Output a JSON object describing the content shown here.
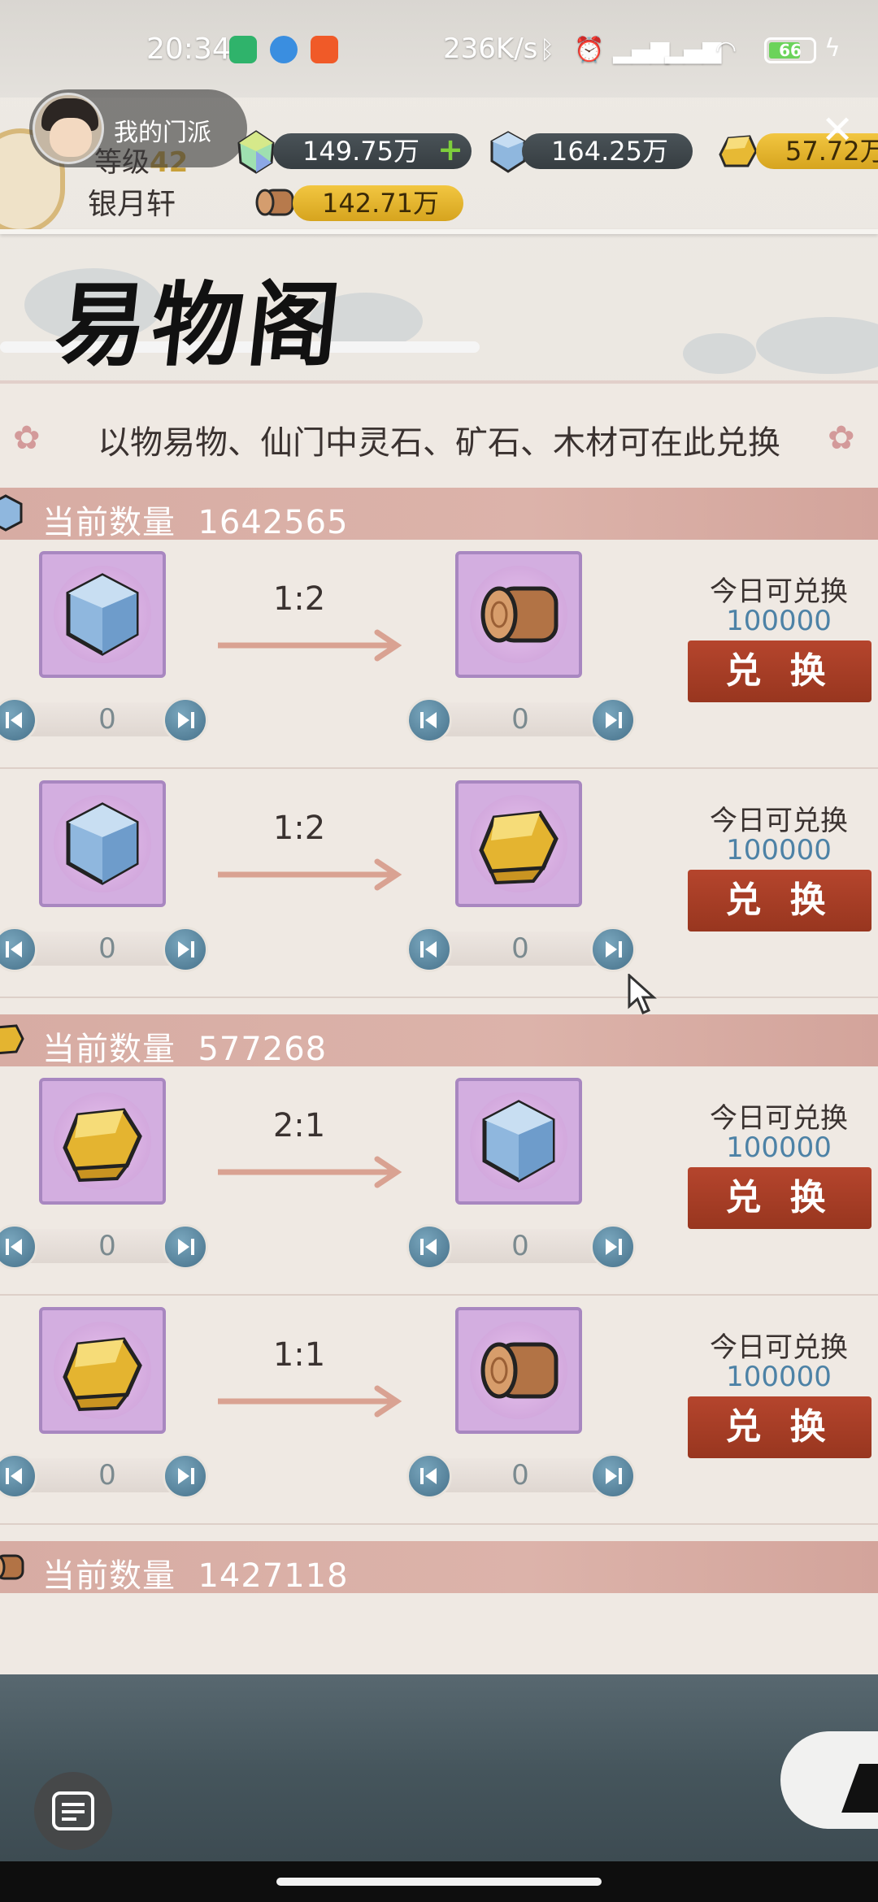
{
  "status_bar": {
    "time": "20:34",
    "network_speed": "236K/s",
    "battery_level": "66"
  },
  "header": {
    "mini_window_label": "我的门派",
    "level_prefix": "等级",
    "level": "42",
    "sect_name": "银月轩",
    "resources": {
      "spirit_stone": "149.75万",
      "ore": "164.25万",
      "gold": "57.72万",
      "wood": "142.71万"
    },
    "close_icon": "close-icon"
  },
  "page": {
    "title": "易物阁",
    "notice": "以物易物、仙门中灵石、矿石、木材可在此兑换"
  },
  "labels": {
    "current_quantity": "当前数量",
    "today_available": "今日可兑换",
    "exchange_button": "兑 换"
  },
  "sections": [
    {
      "quantity": "1642565",
      "icon": "ore-icon",
      "rows": [
        {
          "from": "ore",
          "to": "wood",
          "ratio": "1:2",
          "from_amount": "0",
          "to_amount": "0",
          "available": "100000"
        },
        {
          "from": "ore",
          "to": "gold",
          "ratio": "1:2",
          "from_amount": "0",
          "to_amount": "0",
          "available": "100000"
        }
      ]
    },
    {
      "quantity": "577268",
      "icon": "gold-icon",
      "rows": [
        {
          "from": "gold",
          "to": "ore",
          "ratio": "2:1",
          "from_amount": "0",
          "to_amount": "0",
          "available": "100000"
        },
        {
          "from": "gold",
          "to": "wood",
          "ratio": "1:1",
          "from_amount": "0",
          "to_amount": "0",
          "available": "100000"
        }
      ]
    },
    {
      "quantity": "1427118",
      "icon": "wood-icon",
      "rows": []
    }
  ],
  "colors": {
    "accent_red": "#a83e27",
    "section_pink": "#d7aca3",
    "slot_purple": "#d3aee0",
    "available_blue": "#4d82a6"
  }
}
